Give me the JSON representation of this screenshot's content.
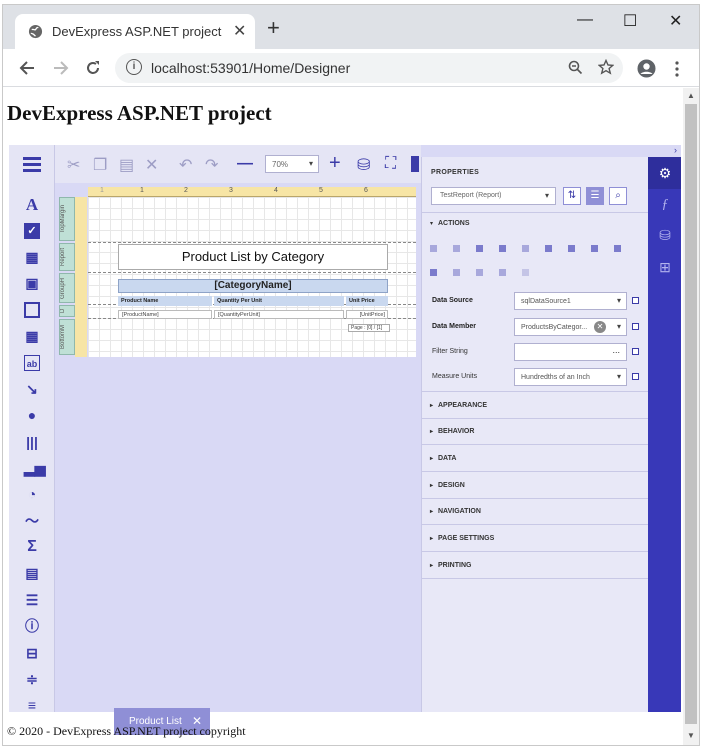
{
  "browser": {
    "tab_title": "DevExpress ASP.NET project",
    "tab_close": "✕",
    "new_tab": "+",
    "window_controls": [
      "—",
      "☐",
      "✕"
    ],
    "url": "localhost:53901/Home/Designer",
    "info_icon": "i"
  },
  "page": {
    "heading": "DevExpress ASP.NET project",
    "footer": "© 2020 - DevExpress ASP.NET project copyright"
  },
  "designer": {
    "toolbar": {
      "zoom": "70%"
    },
    "ruler_ticks": [
      "1",
      "1",
      "2",
      "3",
      "4",
      "5",
      "6"
    ],
    "bands": [
      "TopMargin",
      "Report",
      "GroupH",
      "D",
      "BottomM"
    ],
    "report": {
      "title": "Product List by Category",
      "category": "[CategoryName]",
      "headers": [
        "Product Name",
        "Quantity Per Unit",
        "Unit Price"
      ],
      "details": [
        "[ProductName]",
        "[QuantityPerUnit]",
        "[UnitPrice]"
      ],
      "page_info": "Page : [0] / [1]"
    },
    "bottom_tab": {
      "label": "Product List",
      "close": "✕"
    }
  },
  "properties": {
    "title": "PROPERTIES",
    "selected": "TestReport (Report)",
    "actions_label": "ACTIONS",
    "rows": {
      "data_source": {
        "label": "Data Source",
        "value": "sqlDataSource1"
      },
      "data_member": {
        "label": "Data Member",
        "value": "ProductsByCategor..."
      },
      "filter_string": {
        "label": "Filter String",
        "value": "..."
      },
      "measure_units": {
        "label": "Measure Units",
        "value": "Hundredths of an Inch"
      }
    },
    "sections": [
      "APPEARANCE",
      "BEHAVIOR",
      "DATA",
      "DESIGN",
      "NAVIGATION",
      "PAGE SETTINGS",
      "PRINTING"
    ]
  },
  "colors": {
    "accent": "#3b3ba8",
    "panel": "#e8e8f7",
    "sidebar": "#3838b8"
  }
}
